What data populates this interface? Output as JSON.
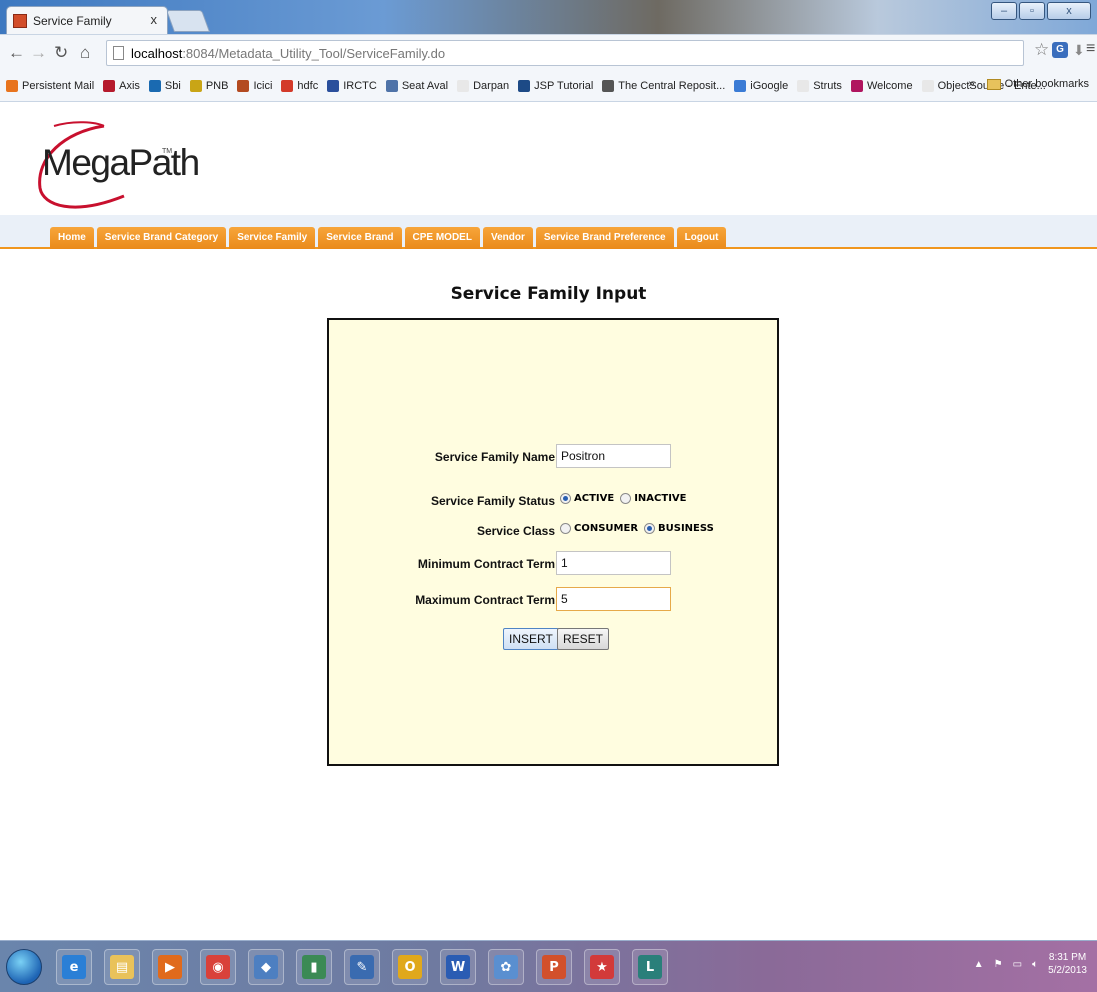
{
  "browser": {
    "tab_title": "Service Family",
    "tab_close": "x",
    "url_host": "localhost",
    "url_path": ":8084/Metadata_Utility_Tool/ServiceFamily.do",
    "bookmarks": [
      {
        "label": "Persistent Mail",
        "color": "#e8741e"
      },
      {
        "label": "Axis",
        "color": "#b51a2c"
      },
      {
        "label": "Sbi",
        "color": "#1a6ab1"
      },
      {
        "label": "PNB",
        "color": "#c9a516"
      },
      {
        "label": "Icici",
        "color": "#b34a20"
      },
      {
        "label": "hdfc",
        "color": "#d33a2a"
      },
      {
        "label": "IRCTC",
        "color": "#2a4f9c"
      },
      {
        "label": "Seat Aval",
        "color": "#4f73a8"
      },
      {
        "label": "Darpan",
        "color": "#e8e8e8"
      },
      {
        "label": "JSP Tutorial",
        "color": "#1d4a86"
      },
      {
        "label": "The Central Reposit...",
        "color": "#555555"
      },
      {
        "label": "iGoogle",
        "color": "#3a7bd5"
      },
      {
        "label": "Struts",
        "color": "#e8e8e8"
      },
      {
        "label": "Welcome",
        "color": "#b0155f"
      },
      {
        "label": "ObjectSource - Ente...",
        "color": "#e8e8e8"
      }
    ],
    "more": "»",
    "other_bookmarks": "Other bookmarks"
  },
  "logo": {
    "text": "MegaPath",
    "tm": "TM"
  },
  "nav": [
    "Home",
    "Service Brand Category",
    "Service Family",
    "Service Brand",
    "CPE MODEL",
    "Vendor",
    "Service Brand Preference",
    "Logout"
  ],
  "form": {
    "title": "Service Family Input",
    "name_label": "Service Family Name",
    "name_value": "Positron",
    "status_label": "Service Family Status",
    "status_options": [
      "ACTIVE",
      "INACTIVE"
    ],
    "status_selected": "ACTIVE",
    "class_label": "Service Class",
    "class_options": [
      "CONSUMER",
      "BUSINESS"
    ],
    "class_selected": "BUSINESS",
    "min_label": "Minimum Contract Term",
    "min_value": "1",
    "max_label": "Maximum Contract Term",
    "max_value": "5",
    "insert_label": "INSERT",
    "reset_label": "RESET"
  },
  "taskbar": {
    "time": "8:31 PM",
    "date": "5/2/2013",
    "apps": [
      {
        "name": "ie",
        "glyph": "e",
        "color": "#2a7fd6"
      },
      {
        "name": "explorer",
        "glyph": "▤",
        "color": "#e9c25a"
      },
      {
        "name": "media",
        "glyph": "▶",
        "color": "#e06a1c"
      },
      {
        "name": "chrome",
        "glyph": "◉",
        "color": "#d9413a"
      },
      {
        "name": "virtualbox",
        "glyph": "◆",
        "color": "#4d7fc1"
      },
      {
        "name": "sqldeveloper",
        "glyph": "▮",
        "color": "#3b8a55"
      },
      {
        "name": "notes",
        "glyph": "✎",
        "color": "#3a6bb0"
      },
      {
        "name": "outlook",
        "glyph": "O",
        "color": "#e0a81c"
      },
      {
        "name": "word",
        "glyph": "W",
        "color": "#2a5cb3"
      },
      {
        "name": "paint",
        "glyph": "✿",
        "color": "#5a8fd0"
      },
      {
        "name": "powerpoint",
        "glyph": "P",
        "color": "#d2502b"
      },
      {
        "name": "star",
        "glyph": "★",
        "color": "#d23a3a"
      },
      {
        "name": "lync",
        "glyph": "L",
        "color": "#2a7f7a"
      }
    ]
  }
}
